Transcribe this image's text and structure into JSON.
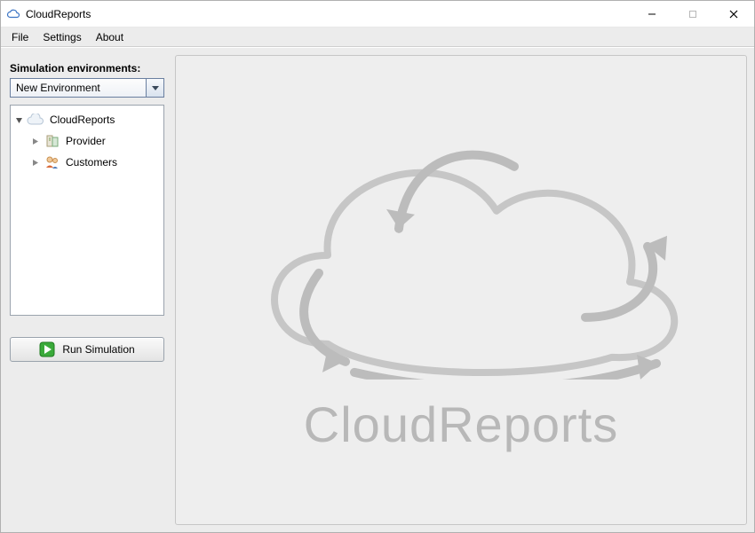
{
  "titlebar": {
    "title": "CloudReports"
  },
  "menubar": {
    "items": [
      "File",
      "Settings",
      "About"
    ]
  },
  "sidebar": {
    "label": "Simulation environments:",
    "combo_value": "New Environment",
    "tree": {
      "root": {
        "label": "CloudReports"
      },
      "children": [
        {
          "label": "Provider"
        },
        {
          "label": "Customers"
        }
      ]
    },
    "run_button_label": "Run Simulation"
  },
  "content": {
    "watermark_text": "CloudReports"
  }
}
